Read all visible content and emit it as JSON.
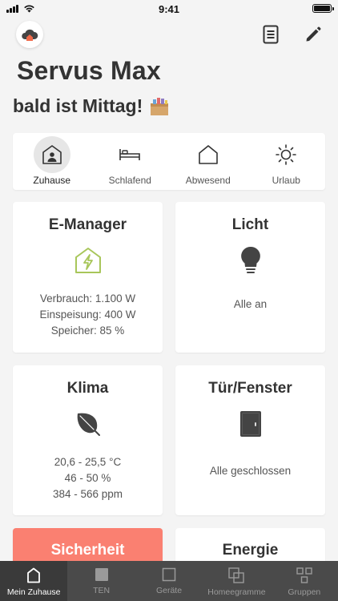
{
  "status_bar": {
    "time": "9:41"
  },
  "greeting": {
    "name": "Servus Max",
    "subtitle": "bald ist Mittag!"
  },
  "modes": [
    {
      "label": "Zuhause",
      "icon": "house-person-icon",
      "active": true
    },
    {
      "label": "Schlafend",
      "icon": "bed-icon",
      "active": false
    },
    {
      "label": "Abwesend",
      "icon": "house-icon",
      "active": false
    },
    {
      "label": "Urlaub",
      "icon": "sun-icon",
      "active": false
    }
  ],
  "tiles": {
    "emanager": {
      "title": "E-Manager",
      "icon": "energy-house-icon",
      "lines": [
        "Verbrauch: 1.100 W",
        "Einspeisung: 400 W",
        "Speicher: 85 %"
      ]
    },
    "licht": {
      "title": "Licht",
      "icon": "lightbulb-icon",
      "status": "Alle an"
    },
    "klima": {
      "title": "Klima",
      "icon": "leaf-icon",
      "lines": [
        "20,6 - 25,5 °C",
        "46 - 50 %",
        "384 - 566 ppm"
      ]
    },
    "tuer": {
      "title": "Tür/Fenster",
      "icon": "door-icon",
      "status": "Alle geschlossen"
    },
    "sicherheit": {
      "title": "Sicherheit"
    },
    "energie": {
      "title": "Energie"
    }
  },
  "bottom_nav": [
    {
      "label": "Mein Zuhause",
      "icon": "house-icon",
      "active": true
    },
    {
      "label": "TEN",
      "icon": "square-filled-icon",
      "active": false
    },
    {
      "label": "Geräte",
      "icon": "square-outline-icon",
      "active": false
    },
    {
      "label": "Homeegramme",
      "icon": "stacked-squares-icon",
      "active": false
    },
    {
      "label": "Gruppen",
      "icon": "grid-squares-icon",
      "active": false
    }
  ],
  "colors": {
    "background": "#f4f4f4",
    "accent_green": "#a8c65a",
    "alert": "#fa8071",
    "nav_background": "#4a4a4a"
  }
}
